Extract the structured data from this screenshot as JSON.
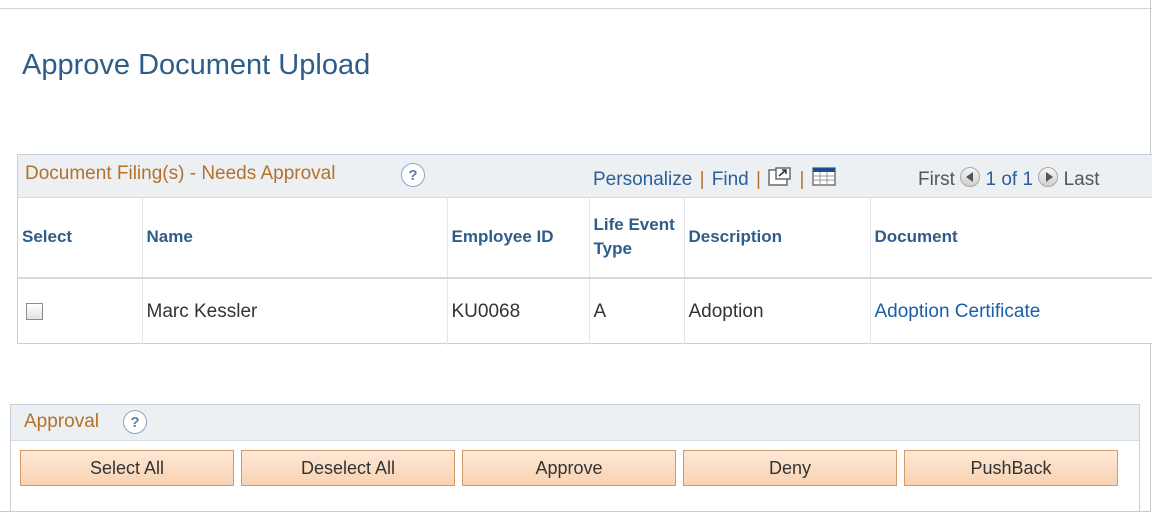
{
  "page": {
    "title": "Approve Document Upload"
  },
  "grid": {
    "title": "Document Filing(s) - Needs Approval",
    "help_label": "?",
    "nav": {
      "personalize": "Personalize",
      "find": "Find",
      "sep": "|"
    },
    "pager": {
      "first": "First",
      "range": "1 of 1",
      "last": "Last"
    },
    "columns": [
      "Select",
      "Name",
      "Employee ID",
      "Life Event Type",
      "Description",
      "Document"
    ],
    "rows": [
      {
        "selected": false,
        "name": "Marc Kessler",
        "employee_id": "KU0068",
        "life_event_type": "A",
        "description": "Adoption",
        "document": "Adoption Certificate"
      }
    ]
  },
  "approval": {
    "title": "Approval",
    "help_label": "?",
    "buttons": {
      "select_all": "Select All",
      "deselect_all": "Deselect All",
      "approve": "Approve",
      "deny": "Deny",
      "pushback": "PushBack"
    }
  },
  "icons": {
    "view_all": "new-window-icon",
    "download": "spreadsheet-icon",
    "prev": "left-arrow-icon",
    "next": "right-arrow-icon"
  },
  "colors": {
    "title": "#2f5d8a",
    "section_title": "#b4712c",
    "link": "#2b5f96",
    "button_bg": "#f8d2b2"
  }
}
